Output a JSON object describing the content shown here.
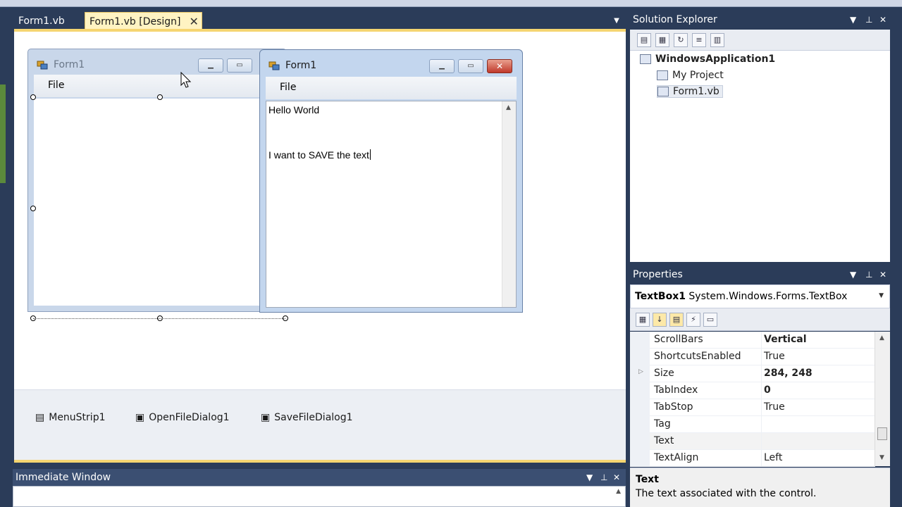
{
  "tabs": [
    {
      "label": "Form1.vb",
      "active": false
    },
    {
      "label": "Form1.vb [Design]",
      "active": true
    }
  ],
  "tab_close_glyph": "✕",
  "design_form": {
    "title": "Form1",
    "menu_file": "File"
  },
  "run_form": {
    "title": "Form1",
    "menu_file": "File",
    "textbox_lines": [
      "Hello World",
      "I want to SAVE the text"
    ]
  },
  "tray_items": [
    "MenuStrip1",
    "OpenFileDialog1",
    "SaveFileDialog1"
  ],
  "solution_explorer": {
    "title": "Solution Explorer",
    "solution": "WindowsApplication1",
    "items": [
      "My Project",
      "Form1.vb"
    ]
  },
  "properties": {
    "title": "Properties",
    "object_name": "TextBox1",
    "object_type": "System.Windows.Forms.TextBox",
    "rows": [
      {
        "name": "ScrollBars",
        "value": "Vertical",
        "bold": true
      },
      {
        "name": "ShortcutsEnabled",
        "value": "True",
        "bold": false
      },
      {
        "name": "Size",
        "value": "284, 248",
        "bold": true
      },
      {
        "name": "TabIndex",
        "value": "0",
        "bold": true
      },
      {
        "name": "TabStop",
        "value": "True",
        "bold": false
      },
      {
        "name": "Tag",
        "value": "",
        "bold": false
      },
      {
        "name": "Text",
        "value": "",
        "bold": false
      },
      {
        "name": "TextAlign",
        "value": "Left",
        "bold": false
      }
    ],
    "description_title": "Text",
    "description": "The text associated with the control."
  },
  "immediate_window": {
    "title": "Immediate Window"
  },
  "colors": {
    "panel_header": "#3b4f72",
    "accent": "#f5d571",
    "background": "#2b3c59"
  }
}
